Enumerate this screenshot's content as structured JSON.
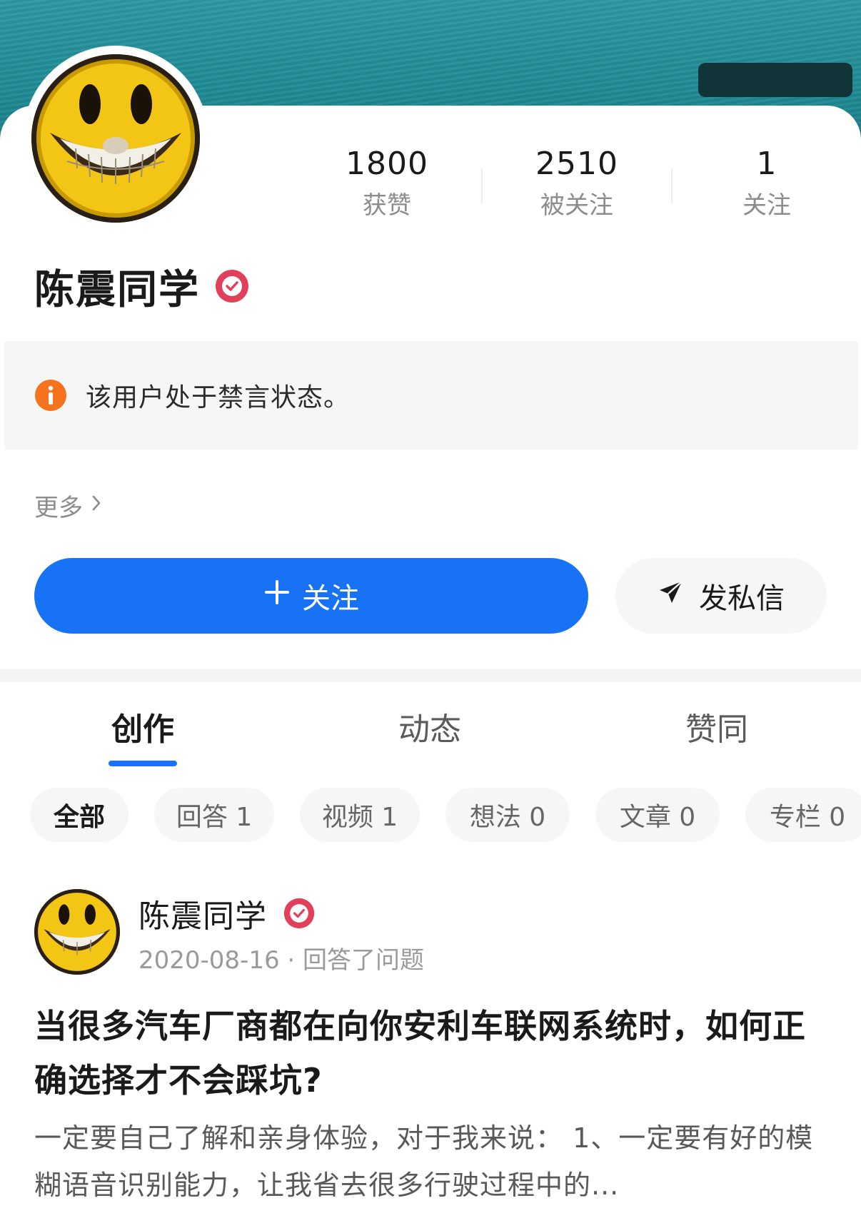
{
  "profile": {
    "name": "陈震同学",
    "stats": [
      {
        "value": "1800",
        "label": "获赞"
      },
      {
        "value": "2510",
        "label": "被关注"
      },
      {
        "value": "1",
        "label": "关注"
      }
    ]
  },
  "notice": {
    "text": "该用户处于禁言状态。"
  },
  "more": {
    "label": "更多"
  },
  "actions": {
    "follow_label": "关注",
    "message_label": "发私信"
  },
  "tabs": [
    {
      "label": "创作",
      "active": true
    },
    {
      "label": "动态",
      "active": false
    },
    {
      "label": "赞同",
      "active": false
    }
  ],
  "filters": [
    {
      "label": "全部",
      "active": true
    },
    {
      "label": "回答 1",
      "active": false
    },
    {
      "label": "视频 1",
      "active": false
    },
    {
      "label": "想法 0",
      "active": false
    },
    {
      "label": "文章 0",
      "active": false
    },
    {
      "label": "专栏 0",
      "active": false
    }
  ],
  "post": {
    "author": "陈震同学",
    "meta": "2020-08-16 · 回答了问题",
    "title": "当很多汽车厂商都在向你安利车联网系统时，如何正确选择才不会踩坑?",
    "excerpt": "一定要自己了解和亲身体验，对于我来说：  1、一定要有好的模糊语音识别能力，让我省去很多行驶过程中的..."
  },
  "colors": {
    "accent": "#1772f6",
    "banner": "#2b98a3",
    "badge": "#e0405a",
    "notice_icon": "#f5731f"
  },
  "icons": {
    "verified": "verified-check-icon",
    "info": "info-icon",
    "chevron": "chevron-right-icon",
    "plus": "plus-icon",
    "send": "paper-plane-icon"
  }
}
